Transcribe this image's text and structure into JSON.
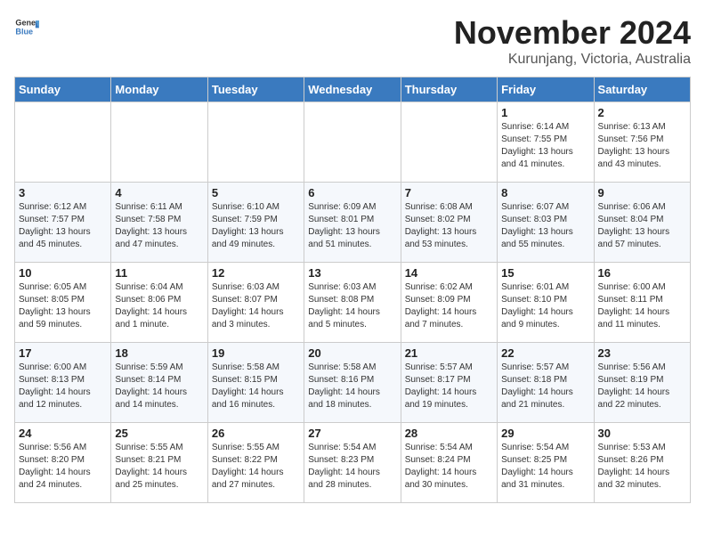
{
  "header": {
    "logo_general": "General",
    "logo_blue": "Blue",
    "month_title": "November 2024",
    "location": "Kurunjang, Victoria, Australia"
  },
  "weekdays": [
    "Sunday",
    "Monday",
    "Tuesday",
    "Wednesday",
    "Thursday",
    "Friday",
    "Saturday"
  ],
  "weeks": [
    [
      {
        "day": "",
        "info": ""
      },
      {
        "day": "",
        "info": ""
      },
      {
        "day": "",
        "info": ""
      },
      {
        "day": "",
        "info": ""
      },
      {
        "day": "",
        "info": ""
      },
      {
        "day": "1",
        "info": "Sunrise: 6:14 AM\nSunset: 7:55 PM\nDaylight: 13 hours\nand 41 minutes."
      },
      {
        "day": "2",
        "info": "Sunrise: 6:13 AM\nSunset: 7:56 PM\nDaylight: 13 hours\nand 43 minutes."
      }
    ],
    [
      {
        "day": "3",
        "info": "Sunrise: 6:12 AM\nSunset: 7:57 PM\nDaylight: 13 hours\nand 45 minutes."
      },
      {
        "day": "4",
        "info": "Sunrise: 6:11 AM\nSunset: 7:58 PM\nDaylight: 13 hours\nand 47 minutes."
      },
      {
        "day": "5",
        "info": "Sunrise: 6:10 AM\nSunset: 7:59 PM\nDaylight: 13 hours\nand 49 minutes."
      },
      {
        "day": "6",
        "info": "Sunrise: 6:09 AM\nSunset: 8:01 PM\nDaylight: 13 hours\nand 51 minutes."
      },
      {
        "day": "7",
        "info": "Sunrise: 6:08 AM\nSunset: 8:02 PM\nDaylight: 13 hours\nand 53 minutes."
      },
      {
        "day": "8",
        "info": "Sunrise: 6:07 AM\nSunset: 8:03 PM\nDaylight: 13 hours\nand 55 minutes."
      },
      {
        "day": "9",
        "info": "Sunrise: 6:06 AM\nSunset: 8:04 PM\nDaylight: 13 hours\nand 57 minutes."
      }
    ],
    [
      {
        "day": "10",
        "info": "Sunrise: 6:05 AM\nSunset: 8:05 PM\nDaylight: 13 hours\nand 59 minutes."
      },
      {
        "day": "11",
        "info": "Sunrise: 6:04 AM\nSunset: 8:06 PM\nDaylight: 14 hours\nand 1 minute."
      },
      {
        "day": "12",
        "info": "Sunrise: 6:03 AM\nSunset: 8:07 PM\nDaylight: 14 hours\nand 3 minutes."
      },
      {
        "day": "13",
        "info": "Sunrise: 6:03 AM\nSunset: 8:08 PM\nDaylight: 14 hours\nand 5 minutes."
      },
      {
        "day": "14",
        "info": "Sunrise: 6:02 AM\nSunset: 8:09 PM\nDaylight: 14 hours\nand 7 minutes."
      },
      {
        "day": "15",
        "info": "Sunrise: 6:01 AM\nSunset: 8:10 PM\nDaylight: 14 hours\nand 9 minutes."
      },
      {
        "day": "16",
        "info": "Sunrise: 6:00 AM\nSunset: 8:11 PM\nDaylight: 14 hours\nand 11 minutes."
      }
    ],
    [
      {
        "day": "17",
        "info": "Sunrise: 6:00 AM\nSunset: 8:13 PM\nDaylight: 14 hours\nand 12 minutes."
      },
      {
        "day": "18",
        "info": "Sunrise: 5:59 AM\nSunset: 8:14 PM\nDaylight: 14 hours\nand 14 minutes."
      },
      {
        "day": "19",
        "info": "Sunrise: 5:58 AM\nSunset: 8:15 PM\nDaylight: 14 hours\nand 16 minutes."
      },
      {
        "day": "20",
        "info": "Sunrise: 5:58 AM\nSunset: 8:16 PM\nDaylight: 14 hours\nand 18 minutes."
      },
      {
        "day": "21",
        "info": "Sunrise: 5:57 AM\nSunset: 8:17 PM\nDaylight: 14 hours\nand 19 minutes."
      },
      {
        "day": "22",
        "info": "Sunrise: 5:57 AM\nSunset: 8:18 PM\nDaylight: 14 hours\nand 21 minutes."
      },
      {
        "day": "23",
        "info": "Sunrise: 5:56 AM\nSunset: 8:19 PM\nDaylight: 14 hours\nand 22 minutes."
      }
    ],
    [
      {
        "day": "24",
        "info": "Sunrise: 5:56 AM\nSunset: 8:20 PM\nDaylight: 14 hours\nand 24 minutes."
      },
      {
        "day": "25",
        "info": "Sunrise: 5:55 AM\nSunset: 8:21 PM\nDaylight: 14 hours\nand 25 minutes."
      },
      {
        "day": "26",
        "info": "Sunrise: 5:55 AM\nSunset: 8:22 PM\nDaylight: 14 hours\nand 27 minutes."
      },
      {
        "day": "27",
        "info": "Sunrise: 5:54 AM\nSunset: 8:23 PM\nDaylight: 14 hours\nand 28 minutes."
      },
      {
        "day": "28",
        "info": "Sunrise: 5:54 AM\nSunset: 8:24 PM\nDaylight: 14 hours\nand 30 minutes."
      },
      {
        "day": "29",
        "info": "Sunrise: 5:54 AM\nSunset: 8:25 PM\nDaylight: 14 hours\nand 31 minutes."
      },
      {
        "day": "30",
        "info": "Sunrise: 5:53 AM\nSunset: 8:26 PM\nDaylight: 14 hours\nand 32 minutes."
      }
    ]
  ]
}
